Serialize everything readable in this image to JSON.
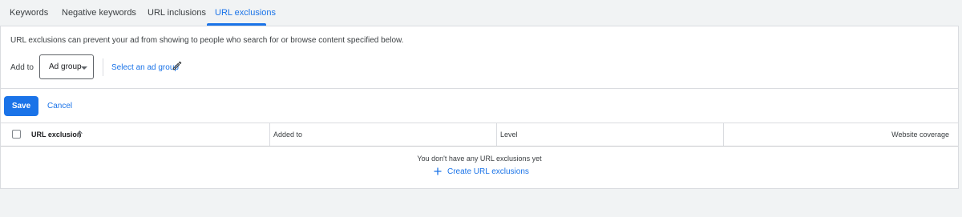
{
  "tabs": [
    {
      "label": "Keywords"
    },
    {
      "label": "Negative keywords"
    },
    {
      "label": "URL inclusions"
    },
    {
      "label": "URL exclusions",
      "active": true
    }
  ],
  "description": "URL exclusions can prevent your ad from showing to people who search for or browse content specified below.",
  "add_to": {
    "label": "Add to",
    "select_value": "Ad group",
    "link_text": "Select an ad group"
  },
  "actions": {
    "save_label": "Save",
    "cancel_label": "Cancel"
  },
  "table": {
    "columns": [
      "URL exclusion",
      "Added to",
      "Level",
      "Website coverage"
    ],
    "empty_message": "You don't have any URL exclusions yet",
    "create_label": "Create URL exclusions"
  },
  "colors": {
    "accent": "#1a73e8",
    "background": "#f1f3f4",
    "panel": "#ffffff",
    "border": "#dadce0"
  },
  "icons": {
    "dropdown": "caret-down-icon",
    "edit": "pencil-icon",
    "sort": "arrow-up-icon",
    "create": "plus-icon"
  }
}
